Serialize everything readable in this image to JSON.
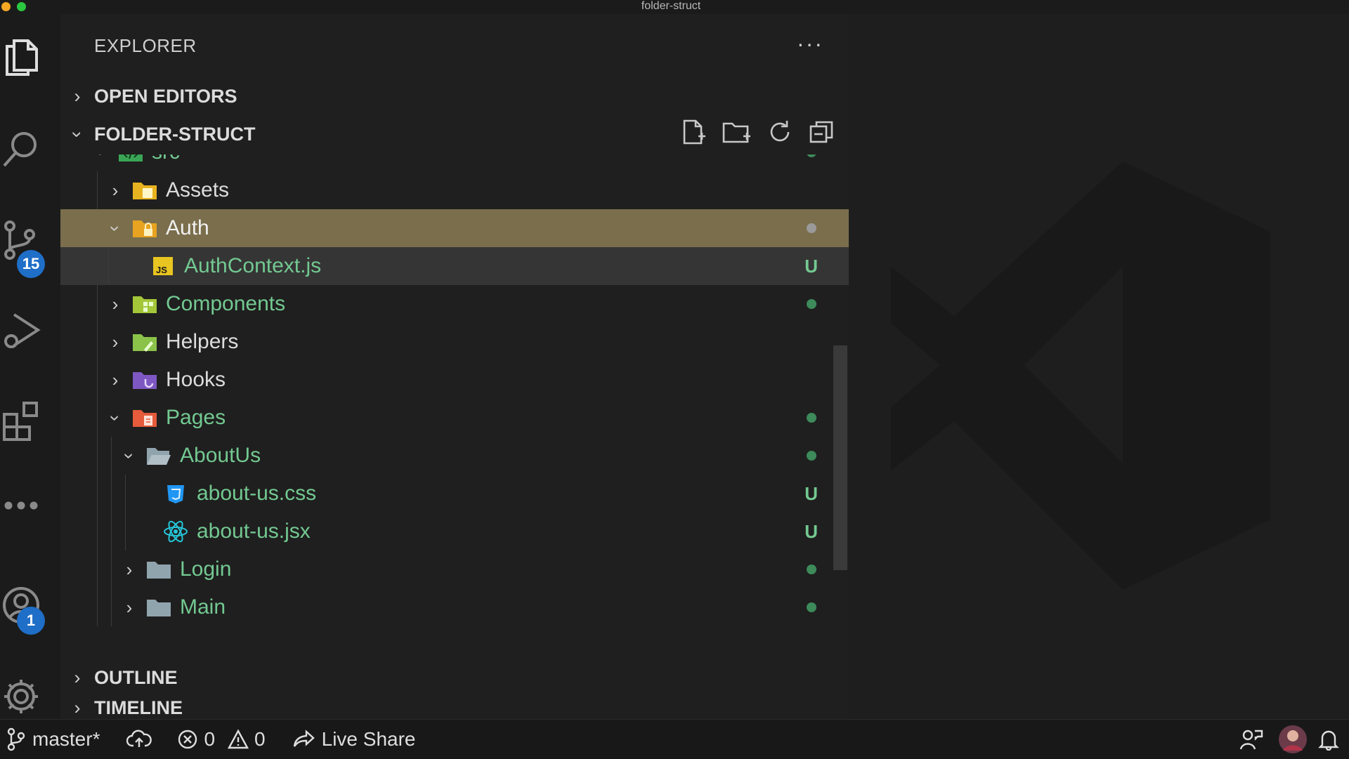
{
  "window": {
    "title": "folder-struct"
  },
  "activity_bar": {
    "items": [
      {
        "icon": "files-icon"
      },
      {
        "icon": "search-icon"
      },
      {
        "icon": "source-control-icon",
        "badge": "15"
      },
      {
        "icon": "run-debug-icon"
      },
      {
        "icon": "extensions-icon"
      },
      {
        "icon": "more-icon"
      },
      {
        "icon": "accounts-icon",
        "badge": "1"
      },
      {
        "icon": "settings-gear-icon"
      }
    ]
  },
  "explorer": {
    "header": "EXPLORER",
    "more": "···",
    "open_editors": "OPEN EDITORS",
    "folder_section": "FOLDER-STRUCT",
    "outline": "OUTLINE",
    "timeline": "TIMELINE",
    "tree": [
      {
        "name": "src",
        "type": "folder",
        "expanded": true,
        "status": "dot"
      },
      {
        "name": "Assets",
        "type": "folder",
        "expanded": false,
        "status": ""
      },
      {
        "name": "Auth",
        "type": "folder",
        "expanded": true,
        "status": "dot-grey"
      },
      {
        "name": "AuthContext.js",
        "type": "js",
        "status": "U"
      },
      {
        "name": "Components",
        "type": "folder",
        "expanded": false,
        "status": "dot"
      },
      {
        "name": "Helpers",
        "type": "folder",
        "expanded": false,
        "status": ""
      },
      {
        "name": "Hooks",
        "type": "folder",
        "expanded": false,
        "status": ""
      },
      {
        "name": "Pages",
        "type": "folder",
        "expanded": true,
        "status": "dot"
      },
      {
        "name": "AboutUs",
        "type": "folder",
        "expanded": true,
        "status": "dot"
      },
      {
        "name": "about-us.css",
        "type": "css",
        "status": "U"
      },
      {
        "name": "about-us.jsx",
        "type": "jsx",
        "status": "U"
      },
      {
        "name": "Login",
        "type": "folder",
        "expanded": false,
        "status": "dot"
      },
      {
        "name": "Main",
        "type": "folder",
        "expanded": false,
        "status": "dot"
      }
    ]
  },
  "status_bar": {
    "branch": "master*",
    "errors": "0",
    "warnings": "0",
    "live_share": "Live Share"
  },
  "colors": {
    "untracked_green": "#73c991",
    "selection": "#7a6e4c",
    "badge_blue": "#1f6ec7"
  }
}
